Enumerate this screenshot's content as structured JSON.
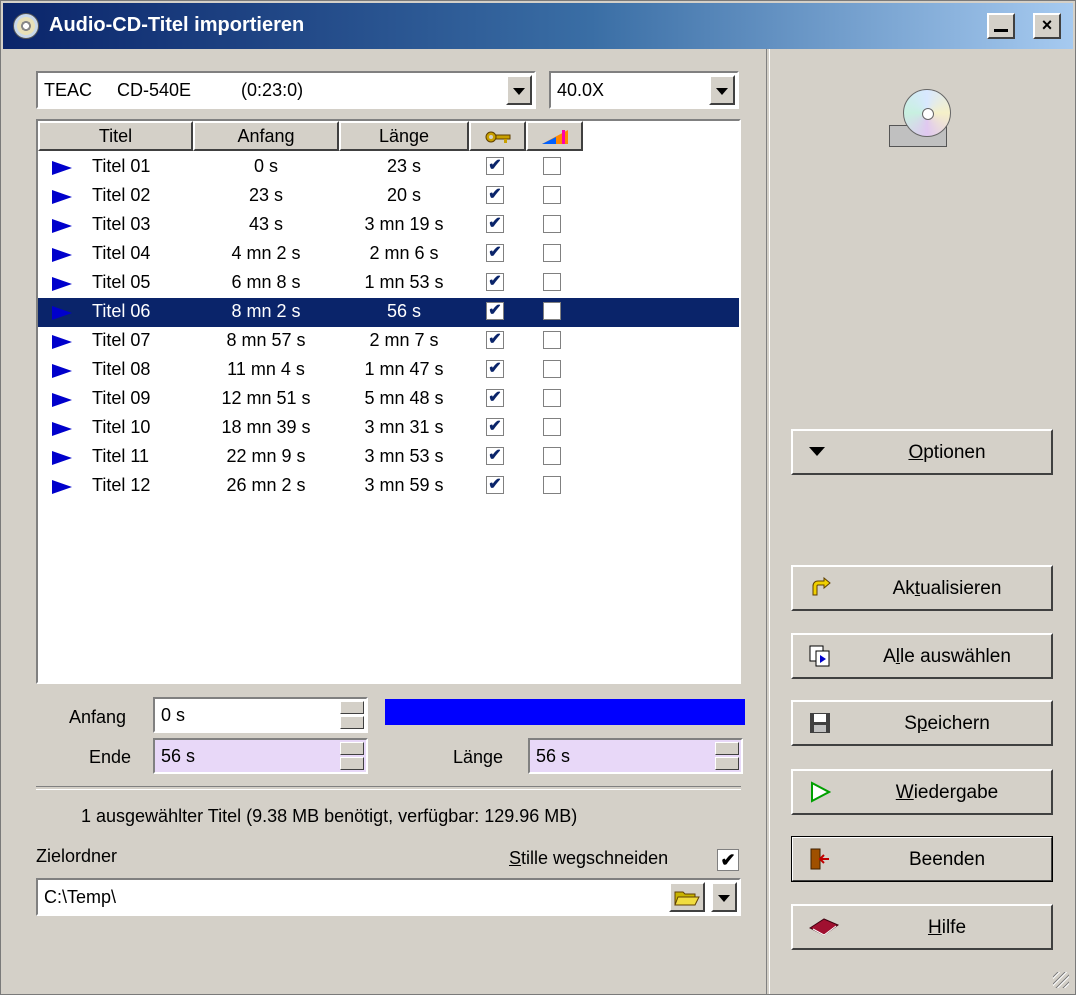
{
  "window": {
    "title": "Audio-CD-Titel importieren",
    "minimize": "_",
    "close": "×"
  },
  "drive_select": {
    "value": "TEAC     CD-540E          (0:23:0)"
  },
  "speed_select": {
    "value": "40.0X"
  },
  "columns": [
    "Titel",
    "Anfang",
    "Länge",
    "key-icon",
    "level-icon"
  ],
  "tracks": [
    {
      "title": "Titel 01",
      "start": "0 s",
      "length": "23 s",
      "checked": true,
      "selected": false
    },
    {
      "title": "Titel 02",
      "start": "23 s",
      "length": "20 s",
      "checked": true,
      "selected": false
    },
    {
      "title": "Titel 03",
      "start": "43 s",
      "length": "3 mn 19 s",
      "checked": true,
      "selected": false
    },
    {
      "title": "Titel 04",
      "start": "4 mn 2 s",
      "length": "2 mn 6 s",
      "checked": true,
      "selected": false
    },
    {
      "title": "Titel 05",
      "start": "6 mn 8 s",
      "length": "1 mn 53 s",
      "checked": true,
      "selected": false
    },
    {
      "title": "Titel 06",
      "start": "8 mn 2 s",
      "length": "56 s",
      "checked": true,
      "selected": true
    },
    {
      "title": "Titel 07",
      "start": "8 mn 57 s",
      "length": "2 mn 7 s",
      "checked": true,
      "selected": false
    },
    {
      "title": "Titel 08",
      "start": "11 mn 4 s",
      "length": "1 mn 47 s",
      "checked": true,
      "selected": false
    },
    {
      "title": "Titel 09",
      "start": "12 mn 51 s",
      "length": "5 mn 48 s",
      "checked": true,
      "selected": false
    },
    {
      "title": "Titel 10",
      "start": "18 mn 39 s",
      "length": "3 mn 31 s",
      "checked": true,
      "selected": false
    },
    {
      "title": "Titel 11",
      "start": "22 mn 9 s",
      "length": "3 mn 53 s",
      "checked": true,
      "selected": false
    },
    {
      "title": "Titel 12",
      "start": "26 mn 2 s",
      "length": "3 mn 59 s",
      "checked": true,
      "selected": false
    }
  ],
  "range": {
    "start_label": "Anfang",
    "start_value": "0 s",
    "end_label": "Ende",
    "end_value": "56 s",
    "length_label": "Länge",
    "length_value": "56 s",
    "progress_fraction": 1.0
  },
  "status": "1 ausgewählter Titel (9.38 MB benötigt, verfügbar: 129.96 MB)",
  "target": {
    "label": "Zielordner",
    "path": "C:\\Temp\\",
    "trim_silence_label": "Stille wegschneiden",
    "trim_silence_checked": true
  },
  "buttons": {
    "options": "Optionen",
    "refresh": "Aktualisieren",
    "select_all": "Alle auswählen",
    "save": "Speichern",
    "play": "Wiedergabe",
    "exit": "Beenden",
    "help": "Hilfe"
  },
  "colors": {
    "selection": "#0a246a",
    "progress": "#0000ff",
    "titlebar": "#0a246a"
  }
}
